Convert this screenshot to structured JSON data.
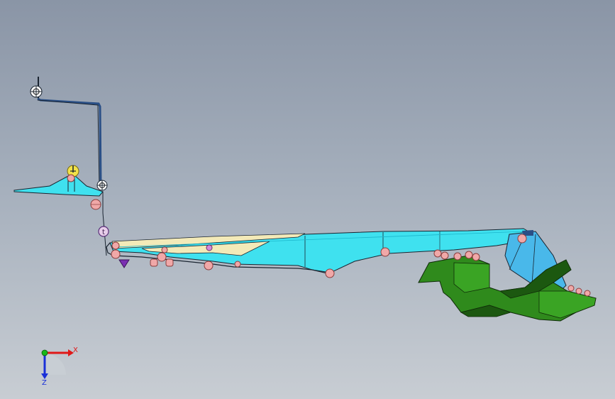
{
  "viewport": {
    "background_top": "#8a95a6",
    "background_bottom": "#c8cdd3"
  },
  "colors": {
    "edge": "#1a2430",
    "fixture_blue": "#2a4f86",
    "part_cyan": "#3fe1ef",
    "part_cyan_dark": "#1bb6cc",
    "part_cream": "#f3eab8",
    "part_green": "#2f8a1c",
    "part_green_dark": "#1c5810",
    "part_sky": "#49b8ea",
    "contact_pink": "#f0a8a8",
    "contact_pink_edge": "#8a3d3d",
    "clamp_yellow": "#f2e24a",
    "pin_purple": "#7a2fb2",
    "axis_x": "#e01818",
    "axis_y": "#18b818",
    "axis_z": "#1a30d8"
  },
  "icons": [
    "fixture-gauge-icon",
    "clamp-yellow-icon",
    "contact-point-icon",
    "locator-pin-icon",
    "coordinate-triad-icon"
  ],
  "triad": {
    "x_label": "X",
    "z_label": "Z"
  }
}
